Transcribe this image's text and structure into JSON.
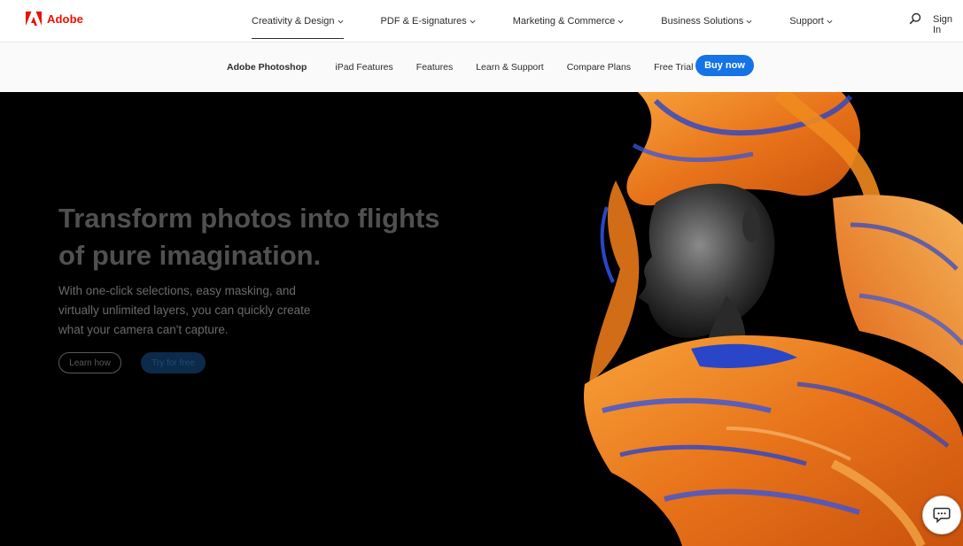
{
  "gnav": {
    "brand": "Adobe",
    "items": [
      {
        "label": "Creativity & Design"
      },
      {
        "label": "PDF & E-signatures"
      },
      {
        "label": "Marketing & Commerce"
      },
      {
        "label": "Business Solutions"
      },
      {
        "label": "Support"
      }
    ],
    "signin": "Sign In"
  },
  "lnav": {
    "title": "Adobe Photoshop",
    "items": [
      "iPad Features",
      "Features",
      "Learn & Support",
      "Compare Plans",
      "Free Trial"
    ],
    "buy": "Buy now"
  },
  "hero": {
    "title": "Transform photos into flights of pure imagination.",
    "copy": "With one-click selections, easy masking, and virtually unlimited layers, you can quickly create what your camera can't capture.",
    "learn_label": "Learn how",
    "try_label": "Try for free"
  },
  "colors": {
    "brand_red": "#eb1000",
    "cta_blue": "#1473e6",
    "hero_bg": "#000000",
    "plume_orange": "#f08a1e",
    "plume_blue": "#2a46c8"
  },
  "icons": [
    "adobe-logo-icon",
    "chevron-down-icon",
    "search-icon",
    "chat-icon"
  ]
}
